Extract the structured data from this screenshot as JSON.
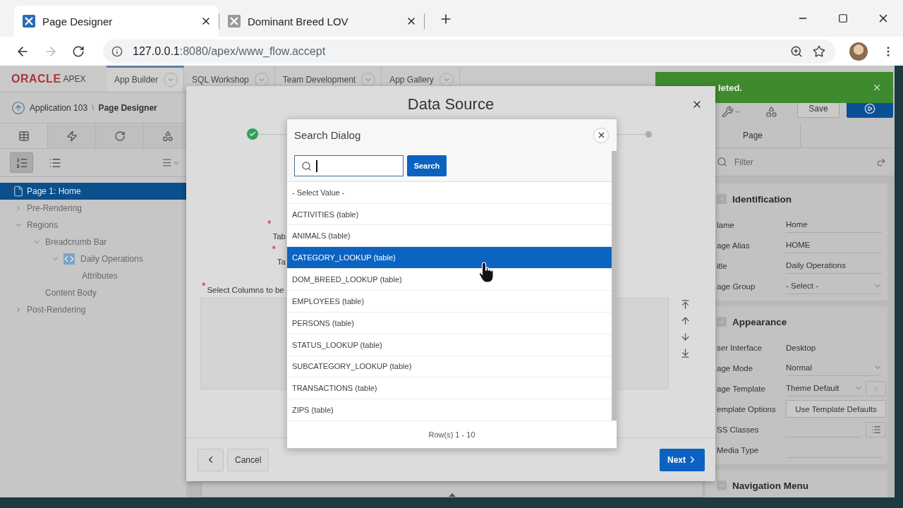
{
  "browser": {
    "tabs": [
      {
        "title": "Page Designer",
        "selected": true
      },
      {
        "title": "Dominant Breed LOV",
        "selected": false
      }
    ],
    "url_host": "127.0.0.1",
    "url_path": ":8080/apex/www_flow.accept"
  },
  "apex": {
    "logo": "ORACLE",
    "product": "APEX",
    "nav_tabs": [
      {
        "label": "App Builder",
        "selected": true
      },
      {
        "label": "SQL Workshop",
        "selected": false
      },
      {
        "label": "Team Development",
        "selected": false
      },
      {
        "label": "App Gallery",
        "selected": false
      }
    ],
    "breadcrumb": {
      "parent": "Application 103",
      "separator": "\\",
      "current": "Page Designer"
    },
    "tree": [
      {
        "label": "Page 1: Home",
        "kind": "page",
        "selected": true
      },
      {
        "label": "Pre-Rendering",
        "kind": "node",
        "selected": false,
        "expanded": false
      },
      {
        "label": "Regions",
        "kind": "node",
        "selected": false,
        "expanded": true,
        "children": [
          {
            "label": "Breadcrumb Bar",
            "kind": "node",
            "selected": false,
            "expanded": true,
            "children": [
              {
                "label": "Daily Operations",
                "kind": "region",
                "selected": false,
                "expanded": true,
                "children": [
                  {
                    "label": "Attributes",
                    "kind": "leaf",
                    "selected": false
                  }
                ]
              }
            ]
          },
          {
            "label": "Content Body",
            "kind": "leaf",
            "selected": false
          }
        ]
      },
      {
        "label": "Post-Rendering",
        "kind": "node",
        "selected": false,
        "expanded": false
      }
    ],
    "toast": {
      "text": "leted."
    },
    "right": {
      "save": "Save",
      "tabs": [
        {
          "label": "Page",
          "selected": true
        }
      ],
      "filter_placeholder": "Filter",
      "groups": [
        {
          "title": "Identification",
          "expanded": true,
          "props": [
            {
              "label": "lame",
              "kind": "text",
              "value": "Home"
            },
            {
              "label": "age Alias",
              "kind": "text",
              "value": "HOME"
            },
            {
              "label": "itle",
              "kind": "text",
              "value": "Daily Operations"
            },
            {
              "label": "age Group",
              "kind": "select",
              "value": "- Select -"
            }
          ]
        },
        {
          "title": "Appearance",
          "expanded": true,
          "props": [
            {
              "label": "ser Interface",
              "kind": "static",
              "value": "Desktop"
            },
            {
              "label": "age Mode",
              "kind": "select",
              "value": "Normal"
            },
            {
              "label": "age Template",
              "kind": "select_link",
              "value": "Theme Default"
            },
            {
              "label": "emplate Options",
              "kind": "button",
              "value": "Use Template Defaults"
            },
            {
              "label": "SS Classes",
              "kind": "picker"
            },
            {
              "label": "Media Type",
              "kind": "text"
            }
          ]
        },
        {
          "title": "Navigation Menu",
          "expanded": true
        }
      ]
    }
  },
  "data_source": {
    "title": "Data Source",
    "steps": [
      {
        "done": true
      },
      {
        "done": false
      }
    ],
    "fields": [
      {
        "marker": "*",
        "label": "Tab"
      },
      {
        "marker": "*",
        "label": "Ta"
      }
    ],
    "columns_field": {
      "marker": "*",
      "label": "Select Columns to be"
    },
    "cancel": "Cancel",
    "next": "Next"
  },
  "search_dialog": {
    "title": "Search Dialog",
    "search_button": "Search",
    "items": [
      {
        "label": "- Select Value -",
        "selected": false
      },
      {
        "label": "ACTIVITIES (table)",
        "selected": false
      },
      {
        "label": "ANIMALS (table)",
        "selected": false
      },
      {
        "label": "CATEGORY_LOOKUP (table)",
        "selected": true
      },
      {
        "label": "DOM_BREED_LOOKUP (table)",
        "selected": false
      },
      {
        "label": "EMPLOYEES (table)",
        "selected": false
      },
      {
        "label": "PERSONS (table)",
        "selected": false
      },
      {
        "label": "STATUS_LOOKUP (table)",
        "selected": false
      },
      {
        "label": "SUBCATEGORY_LOOKUP (table)",
        "selected": false
      },
      {
        "label": "TRANSACTIONS (table)",
        "selected": false
      },
      {
        "label": "ZIPS (table)",
        "selected": false
      }
    ],
    "footer": "Row(s) 1 - 10"
  }
}
